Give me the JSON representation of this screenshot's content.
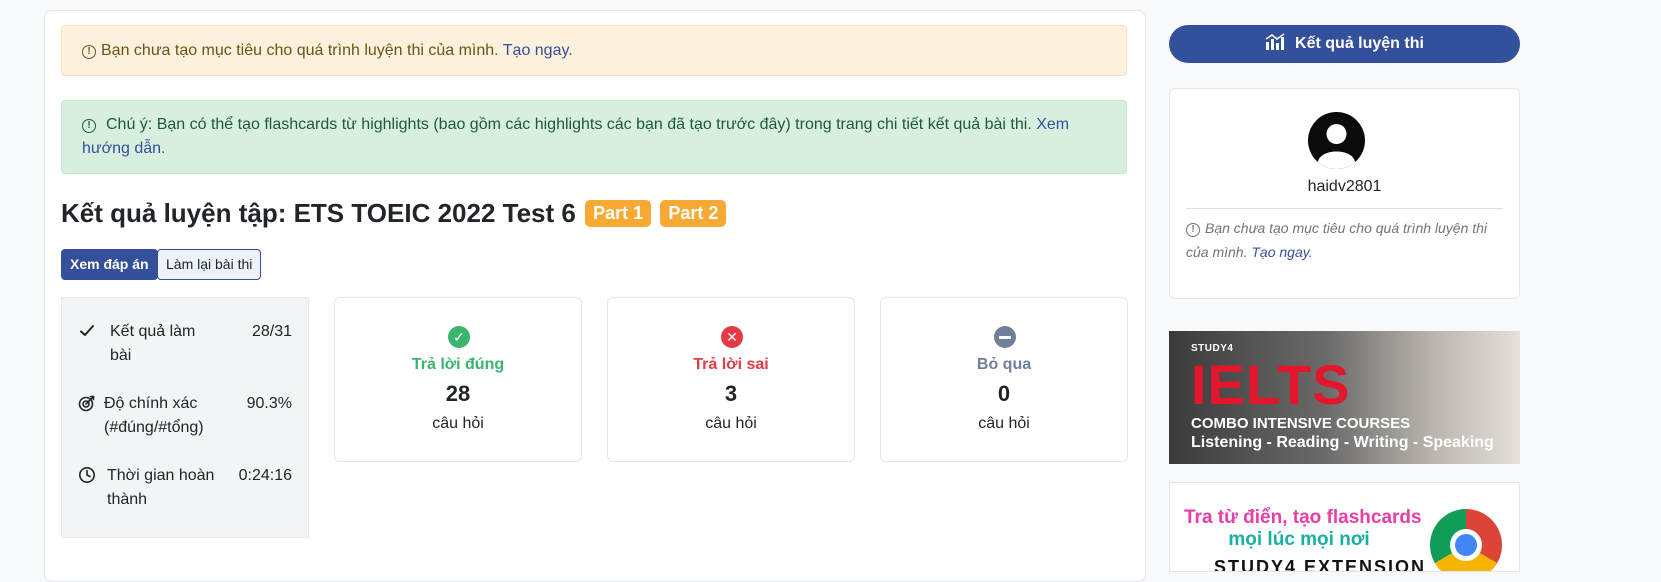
{
  "alerts": {
    "goal_text": "Bạn chưa tạo mục tiêu cho quá trình luyện thi của mình.",
    "goal_link": "Tạo ngay.",
    "flashcard_text": "Chú ý: Bạn có thể tạo flashcards từ highlights (bao gồm các highlights các bạn đã tạo trước đây) trong trang chi tiết kết quả bài thi.",
    "flashcard_link": "Xem hướng dẫn."
  },
  "result": {
    "title": "Kết quả luyện tập: ETS TOEIC 2022 Test 6",
    "parts": [
      "Part 1",
      "Part 2"
    ],
    "view_answers_label": "Xem đáp án",
    "retake_label": "Làm lại bài thi"
  },
  "stats": [
    {
      "icon": "check-icon",
      "label": "Kết quả làm bài",
      "value": "28/31"
    },
    {
      "icon": "target-icon",
      "label": "Độ chính xác (#đúng/#tổng)",
      "value": "90.3%"
    },
    {
      "icon": "clock-icon",
      "label": "Thời gian hoàn thành",
      "value": "0:24:16"
    }
  ],
  "cards": [
    {
      "icon": "check-circle-icon",
      "label": "Trả lời đúng",
      "count": "28",
      "unit": "câu hỏi",
      "color": "#3cb46e"
    },
    {
      "icon": "x-circle-icon",
      "label": "Trả lời sai",
      "count": "3",
      "unit": "câu hỏi",
      "color": "#e43a45"
    },
    {
      "icon": "minus-circle-icon",
      "label": "Bỏ qua",
      "count": "0",
      "unit": "câu hỏi",
      "color": "#71809a"
    }
  ],
  "sidebar": {
    "results_button": "Kết quả luyện thi",
    "username": "haidv2801",
    "goal_note": "Bạn chưa tạo mục tiêu cho quá trình luyện thi của mình.",
    "goal_link": "Tạo ngay."
  },
  "banners": {
    "ielts_brand": "STUDY4",
    "ielts_title": "IELTS",
    "ielts_line1": "COMBO INTENSIVE COURSES",
    "ielts_line2": "Listening - Reading - Writing - Speaking",
    "ext_line1": "Tra từ điển, tạo flashcards",
    "ext_line2": "mọi lúc mọi nơi",
    "ext_line3": "STUDY4 EXTENSION"
  },
  "colors": {
    "primary": "#35509a",
    "badge": "#f8a934"
  }
}
